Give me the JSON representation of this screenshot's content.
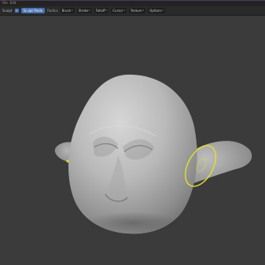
{
  "menubar": {
    "items": [
      "File",
      "Edit"
    ]
  },
  "toolbar": {
    "mode_label": "Sculpt",
    "active_tool": "Sculpt Mode",
    "dropdown_1": "Brush",
    "dropdown_2": "Stroke",
    "dropdown_3": "Falloff",
    "dropdown_4": "Cursor",
    "dropdown_5": "Texture",
    "dropdown_6": "Options",
    "plain_text": "Radius"
  },
  "colors": {
    "viewport_bg": "#3b3b3b",
    "mesh": "#c8c8c8",
    "brush_cursor": "#e0e02a",
    "accent": "#4772b3"
  },
  "icons": {
    "check": "checkmark-icon",
    "chevron": "chevron-down-icon"
  }
}
